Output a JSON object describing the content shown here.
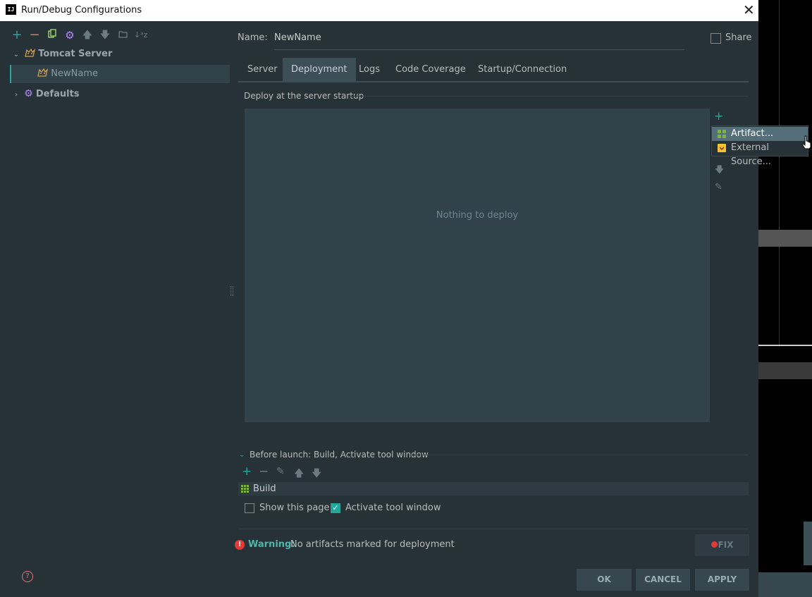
{
  "window": {
    "title": "Run/Debug Configurations",
    "logo": "IJ",
    "close_label": "✕"
  },
  "left_panel": {
    "toolbar_icons": [
      "add-icon",
      "remove-icon",
      "copy-icon",
      "settings-icon",
      "move-up-icon",
      "move-down-icon",
      "folder-icon",
      "sort-icon"
    ],
    "tree": [
      {
        "label": "Tomcat Server",
        "expanded": true,
        "icon": "tomcat-icon"
      },
      {
        "label": "NewName",
        "selected": true,
        "icon": "tomcat-icon"
      },
      {
        "label": "Defaults",
        "expanded": false,
        "icon": "gear-icon"
      }
    ]
  },
  "form": {
    "name_label": "Name:",
    "name_value": "NewName",
    "share_label": "Share",
    "share_checked": false
  },
  "tabs": [
    {
      "label": "Server",
      "active": false
    },
    {
      "label": "Deployment",
      "active": true
    },
    {
      "label": "Logs",
      "active": false
    },
    {
      "label": "Code Coverage",
      "active": false
    },
    {
      "label": "Startup/Connection",
      "active": false
    }
  ],
  "deployment": {
    "section_label": "Deploy at the server startup",
    "empty_text": "Nothing to deploy",
    "add_menu": [
      {
        "label": "Artifact...",
        "icon": "artifact-icon",
        "highlighted": true
      },
      {
        "label": "External Source...",
        "icon": "external-source-icon",
        "highlighted": false
      }
    ]
  },
  "before_launch": {
    "label": "Before launch: Build, Activate tool window",
    "tasks": [
      {
        "label": "Build",
        "icon": "build-icon"
      }
    ],
    "show_this_page_label": "Show this page",
    "show_this_page_checked": false,
    "activate_tool_window_label": "Activate tool window",
    "activate_tool_window_checked": true
  },
  "warning": {
    "label": "Warning:",
    "text": "No artifacts marked for deployment",
    "fix_label": "FIX"
  },
  "buttons": {
    "ok": "OK",
    "cancel": "CANCEL",
    "apply": "APPLY"
  },
  "colors": {
    "background": "#263238",
    "accent": "#26a69a",
    "selection": "#546e7a",
    "error": "#e53935"
  }
}
